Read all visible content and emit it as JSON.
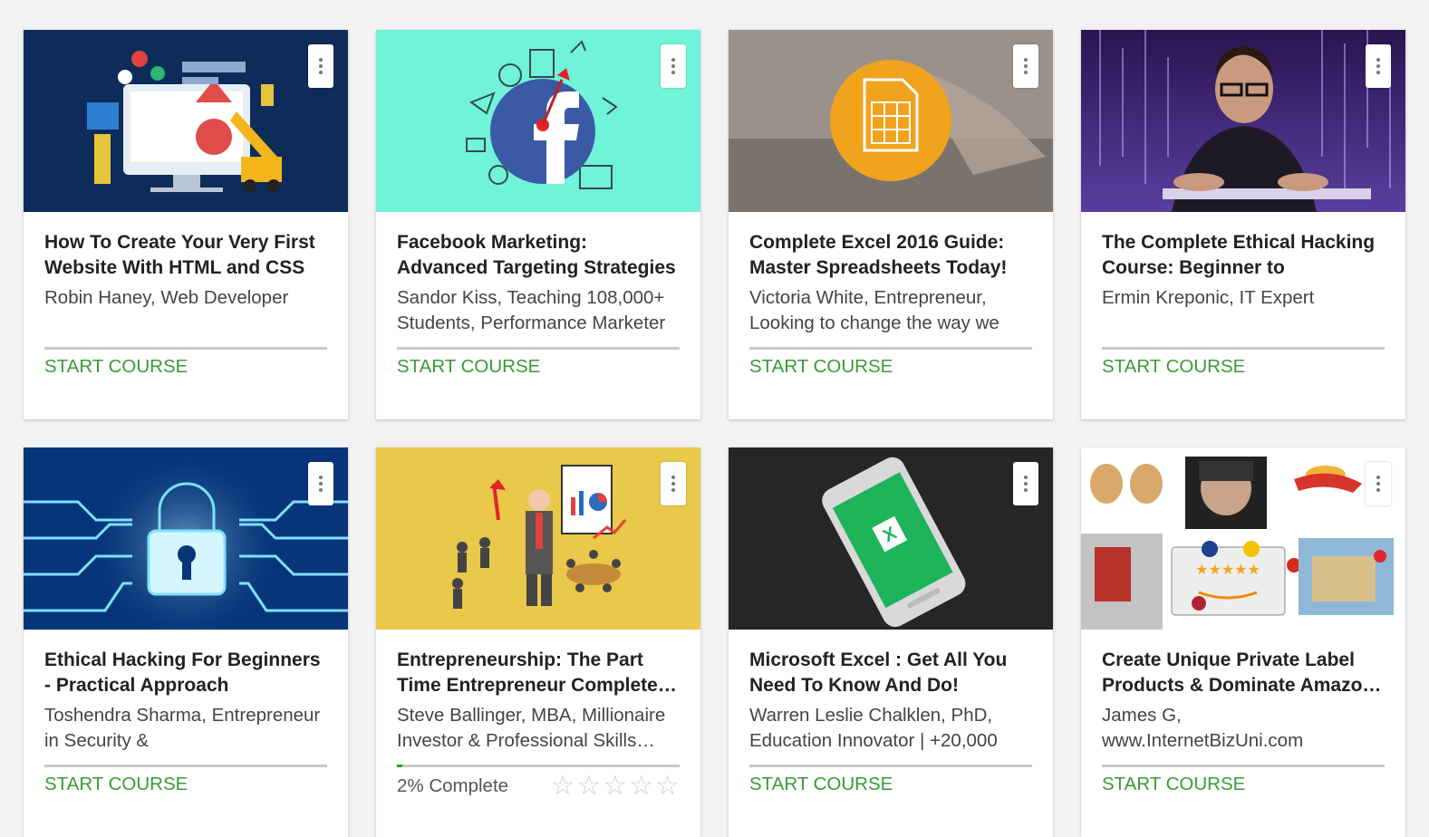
{
  "courses": [
    {
      "title": "How To Create Your Very First Website With HTML and CSS",
      "author": "Robin Haney, Web Developer",
      "action": "START COURSE",
      "bg": "#0d2c5a"
    },
    {
      "title": "Facebook Marketing: Advanced Targeting Strategies",
      "author": "Sandor Kiss, Teaching 108,000+ Students, Performance Marketer",
      "action": "START COURSE",
      "bg": "#6ff3d9"
    },
    {
      "title": "Complete Excel 2016 Guide: Master Spreadsheets Today!",
      "author": "Victoria White, Entrepreneur, Looking to change the way we",
      "action": "START COURSE",
      "bg": "#8a8078"
    },
    {
      "title": "The Complete Ethical Hacking Course: Beginner to Advanced!",
      "author": "Ermin Kreponic, IT Expert",
      "action": "START COURSE",
      "bg": "#3b1f6a"
    },
    {
      "title": "Ethical Hacking For Beginners - Practical Approach",
      "author": "Toshendra Sharma, Entrepreneur in Security &",
      "action": "START COURSE",
      "bg": "#06357a"
    },
    {
      "title": "Entrepreneurship: The Part Time Entrepreneur Complete…",
      "author": "Steve Ballinger, MBA, Millionaire Investor & Professional Skills…",
      "progress_label": "2% Complete",
      "progress": 0.02,
      "rating": 0,
      "bg": "#e9c84a"
    },
    {
      "title": "Microsoft Excel : Get All You Need To Know And Do!",
      "author": "Warren Leslie Chalklen, PhD, Education Innovator | +20,000",
      "action": "START COURSE",
      "bg": "#1e1e1e"
    },
    {
      "title": "Create Unique Private Label Products & Dominate Amazo…",
      "author": "James G, www.InternetBizUni.com",
      "action": "START COURSE",
      "bg": "#ffffff"
    }
  ],
  "star_glyph": "☆",
  "menu_icon": "vertical-ellipsis-icon"
}
